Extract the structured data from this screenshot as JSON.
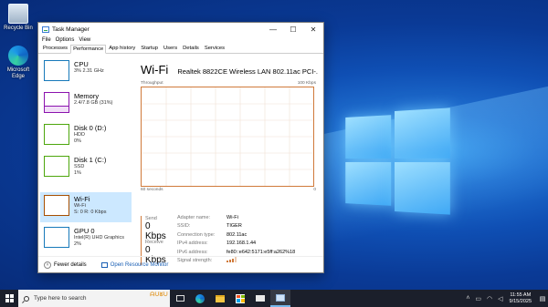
{
  "desktop": {
    "icons": [
      {
        "label": "Recycle Bin"
      },
      {
        "label": "Microsoft Edge"
      }
    ]
  },
  "window": {
    "title": "Task Manager",
    "menu": [
      "File",
      "Options",
      "View"
    ],
    "tabs": [
      "Processes",
      "Performance",
      "App history",
      "Startup",
      "Users",
      "Details",
      "Services"
    ],
    "active_tab": "Performance",
    "controls": {
      "minimize": "—",
      "maximize": "☐",
      "close": "✕"
    }
  },
  "sidebar": {
    "items": [
      {
        "name": "CPU",
        "sub1": "3% 2.31 GHz",
        "sub2": "",
        "color": "#1779ba"
      },
      {
        "name": "Memory",
        "sub1": "2.4/7.8 GB (31%)",
        "sub2": "",
        "color": "#8b12ae"
      },
      {
        "name": "Disk 0 (D:)",
        "sub1": "HDD",
        "sub2": "0%",
        "color": "#4da60c"
      },
      {
        "name": "Disk 1 (C:)",
        "sub1": "SSD",
        "sub2": "1%",
        "color": "#4da60c"
      },
      {
        "name": "Wi-Fi",
        "sub1": "Wi-Fi",
        "sub2": "S: 0 R: 0 Kbps",
        "color": "#a74f01",
        "selected": true
      },
      {
        "name": "GPU 0",
        "sub1": "Intel(R) UHD Graphics",
        "sub2": "2%",
        "color": "#1779ba"
      }
    ]
  },
  "detail": {
    "title": "Wi-Fi",
    "adapter": "Realtek 8822CE Wireless LAN 802.11ac PCI-...",
    "graph_label_left": "Throughput",
    "graph_label_right": "100 Kbps",
    "graph_bottom_left": "60 seconds",
    "graph_bottom_right": "0",
    "send_label": "Send",
    "send_value": "0 Kbps",
    "receive_label": "Receive",
    "receive_value": "0 Kbps",
    "properties": [
      {
        "key": "Adapter name:",
        "value": "Wi-Fi"
      },
      {
        "key": "SSID:",
        "value": "TIGER"
      },
      {
        "key": "Connection type:",
        "value": "802.11ac"
      },
      {
        "key": "IPv4 address:",
        "value": "192.168.1.44"
      },
      {
        "key": "IPv6 address:",
        "value": "fe80::e642:5171:e5ff:a262%18"
      },
      {
        "key": "Signal strength:",
        "value": ""
      }
    ],
    "accent": "#d07a3a"
  },
  "footer": {
    "fewer_details": "Fewer details",
    "resource_monitor": "Open Resource Monitor"
  },
  "taskbar": {
    "search_placeholder": "Type here to search",
    "search_decoration": "ᗩᑌᘜᑌ",
    "time": "11:55 AM",
    "date": "9/15/2025"
  }
}
